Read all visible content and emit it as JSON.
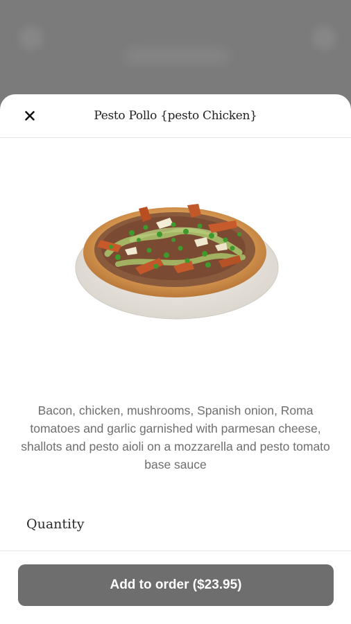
{
  "modal": {
    "title": "Pesto Pollo {pesto Chicken}",
    "close_icon": "close-icon"
  },
  "product": {
    "image_icon": "pizza-image",
    "description": "Bacon, chicken, mushrooms, Spanish onion, Roma tomatoes and garlic garnished with parmesan cheese, shallots and pesto aioli on a mozzarella and pesto tomato base sauce"
  },
  "quantity": {
    "label": "Quantity"
  },
  "footer": {
    "add_button_label": "Add to order ($23.95)"
  },
  "colors": {
    "overlay": "#7b7b7b",
    "button": "#6e6e6e",
    "sheet": "#ffffff"
  }
}
